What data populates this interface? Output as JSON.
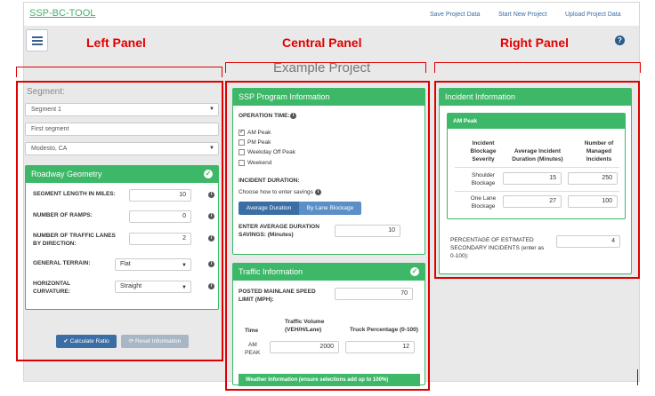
{
  "nav": {
    "brand": "SSP-BC-TOOL",
    "save": "Save Project Data",
    "start": "Start New Project",
    "upload": "Upload Project Data"
  },
  "annotations": {
    "left": "Left Panel",
    "central": "Central Panel",
    "right": "Right Panel"
  },
  "project_title": "Example Project",
  "segment": {
    "label": "Segment:",
    "selected": "Segment 1",
    "name": "First segment",
    "location": "Modesto, CA"
  },
  "roadway": {
    "title": "Roadway Geometry",
    "length_label": "SEGMENT LENGTH IN MILES:",
    "length_value": "10",
    "ramps_label": "NUMBER OF RAMPS:",
    "ramps_value": "0",
    "lanes_label_1": "NUMBER OF TRAFFIC LANES",
    "lanes_label_2": "BY DIRECTION:",
    "lanes_value": "2",
    "terrain_label": "GENERAL TERRAIN:",
    "terrain_value": "Flat",
    "curv_label_1": "HORIZONTAL",
    "curv_label_2": "CURVATURE:",
    "curv_value": "Straight"
  },
  "buttons": {
    "calculate": "Calculate Ratio",
    "reset": "Reset Information"
  },
  "ssp": {
    "title": "SSP Program Information",
    "operation_time": "OPERATION TIME:",
    "am_peak": "AM Peak",
    "pm_peak": "PM Peak",
    "weekday_off": "Weekday Off Peak",
    "weekend": "Weekend",
    "incident_duration": "INCIDENT DURATION:",
    "choose": "Choose how to enter savings",
    "avg_duration_btn": "Average Duration",
    "by_lane_btn": "By Lane Blockage",
    "enter_avg_1": "ENTER AVERAGE DURATION",
    "enter_avg_2": "SAVINGS: (Minutes)",
    "enter_avg_value": "10"
  },
  "traffic": {
    "title": "Traffic Information",
    "posted_1": "POSTED MAINLANE SPEED",
    "posted_2": "LIMIT (MPH):",
    "posted_value": "70",
    "col_time": "Time",
    "col_volume_1": "Traffic Volume",
    "col_volume_2": "(VEH/H/Lane)",
    "col_truck": "Truck Percentage (0-100)",
    "row_label_1": "AM",
    "row_label_2": "PEAK",
    "volume_value": "2000",
    "truck_value": "12",
    "weather": "Weather Information (ensure selections add up to 100%)"
  },
  "incident": {
    "title": "Incident Information",
    "am_peak": "AM Peak",
    "col1_1": "Incident",
    "col1_2": "Blockage",
    "col1_3": "Severity",
    "col2_1": "Average Incident",
    "col2_2": "Duration (Minutes)",
    "col3_1": "Number of",
    "col3_2": "Managed",
    "col3_3": "Incidents",
    "row1_1": "Shoulder",
    "row1_2": "Blockage",
    "row1_dur": "15",
    "row1_num": "250",
    "row2_1": "One Lane",
    "row2_2": "Blockage",
    "row2_dur": "27",
    "row2_num": "100",
    "secondary_1": "PERCENTAGE OF ESTIMATED",
    "secondary_2": "SECONDARY INCIDENTS (enter as",
    "secondary_3": "0-100):",
    "secondary_value": "4"
  },
  "colors": {
    "green": "#3cb868",
    "annotation_red": "#e00000",
    "button_blue": "#3b6ea5"
  }
}
